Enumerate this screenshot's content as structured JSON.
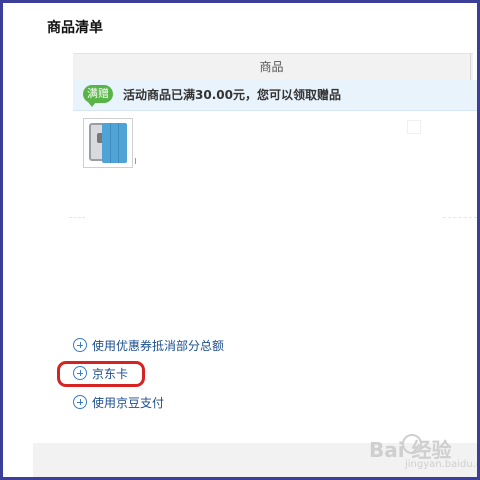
{
  "section": {
    "title": "商品清单"
  },
  "table": {
    "headers": [
      "商品"
    ]
  },
  "promo": {
    "badge": "满赠",
    "text": "活动商品已满30.00元，您可以领取赠品"
  },
  "product": {
    "image": "ipad-smart-cover"
  },
  "options": [
    {
      "label": "使用优惠券抵消部分总额",
      "icon": "plus-circle-icon"
    },
    {
      "label": "京东卡",
      "icon": "plus-circle-icon",
      "highlighted": true
    },
    {
      "label": "使用京豆支付",
      "icon": "plus-circle-icon"
    }
  ],
  "watermark": {
    "main": "Bai  经验",
    "sub": "jingyan.baidu.com"
  },
  "colors": {
    "link": "#1b4e8f",
    "badge": "#58b447",
    "promo_bg": "#e8f3fc",
    "highlight": "#d62222",
    "frame": "#3b3f9a"
  }
}
